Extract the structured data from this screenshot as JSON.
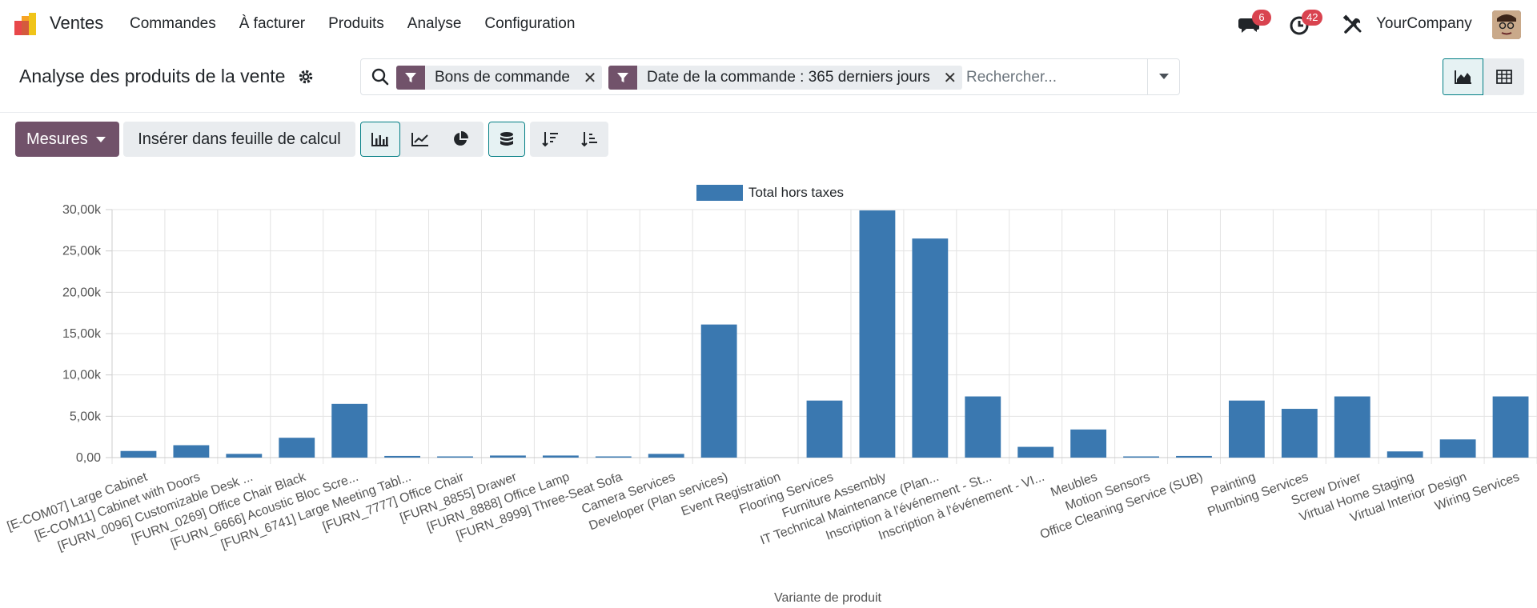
{
  "navbar": {
    "app_name": "Ventes",
    "menu": [
      "Commandes",
      "À facturer",
      "Produits",
      "Analyse",
      "Configuration"
    ],
    "messages_count": "6",
    "activities_count": "42",
    "company": "YourCompany"
  },
  "control_panel": {
    "title": "Analyse des produits de la vente",
    "facets": [
      "Bons de commande",
      "Date de la commande : 365 derniers jours"
    ],
    "search_placeholder": "Rechercher..."
  },
  "toolbar": {
    "measures_label": "Mesures",
    "insert_label": "Insérer dans feuille de calcul"
  },
  "colors": {
    "brand": "#71526a",
    "bar": "#3a78b0",
    "accent": "#017e84",
    "badge": "#d9434f"
  },
  "chart_data": {
    "type": "bar",
    "xlabel": "Variante de produit",
    "ylabel": "",
    "ylim": [
      0,
      30000
    ],
    "yticks": [
      "0,00",
      "5,00k",
      "10,00k",
      "15,00k",
      "20,00k",
      "25,00k",
      "30,00k"
    ],
    "legend_position": "top-center",
    "grid": true,
    "categories": [
      "[E-COM07] Large Cabinet",
      "[E-COM11] Cabinet with Doors",
      "[FURN_0096] Customizable Desk ...",
      "[FURN_0269] Office Chair Black",
      "[FURN_6666] Acoustic Bloc Scre...",
      "[FURN_6741] Large Meeting Tabl...",
      "[FURN_7777] Office Chair",
      "[FURN_8855] Drawer",
      "[FURN_8888] Office Lamp",
      "[FURN_8999] Three-Seat Sofa",
      "Camera Services",
      "Developer (Plan services)",
      "Event Registration",
      "Flooring Services",
      "Furniture Assembly",
      "IT Technical Maintenance (Plan...",
      "Inscription à l'événement - St...",
      "Inscription à l'événement - VI...",
      "Meubles",
      "Motion Sensors",
      "Office Cleaning Service (SUB)",
      "Painting",
      "Plumbing Services",
      "Screw Driver",
      "Virtual Home Staging",
      "Virtual Interior Design",
      "Wiring Services"
    ],
    "series": [
      {
        "name": "Total hors taxes",
        "values": [
          800,
          1500,
          450,
          2400,
          6500,
          200,
          100,
          250,
          250,
          100,
          450,
          16100,
          0,
          6900,
          29900,
          26500,
          7400,
          1300,
          3400,
          100,
          200,
          6900,
          5900,
          7400,
          750,
          2200,
          7400
        ]
      }
    ]
  }
}
